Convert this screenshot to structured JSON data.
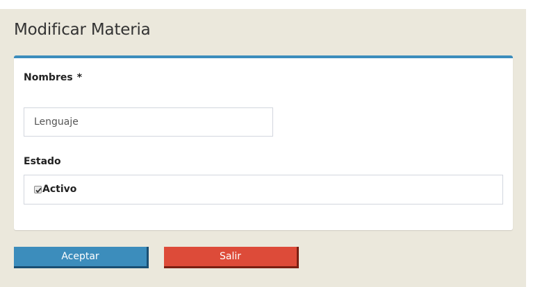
{
  "page": {
    "title": "Modificar Materia"
  },
  "form": {
    "nombres": {
      "label": "Nombres",
      "required_mark": "*",
      "value": "Lenguaje"
    },
    "estado": {
      "label": "Estado",
      "checkbox_label": "Activo",
      "checked": true
    }
  },
  "actions": {
    "accept_label": "Aceptar",
    "exit_label": "Salir"
  },
  "colors": {
    "page_background": "#ebe8dc",
    "panel_accent": "#3c8dbc",
    "accept_button": "#3c8dbc",
    "exit_button": "#dd4b39"
  },
  "icons": {
    "checkbox": "checkmark-icon"
  }
}
